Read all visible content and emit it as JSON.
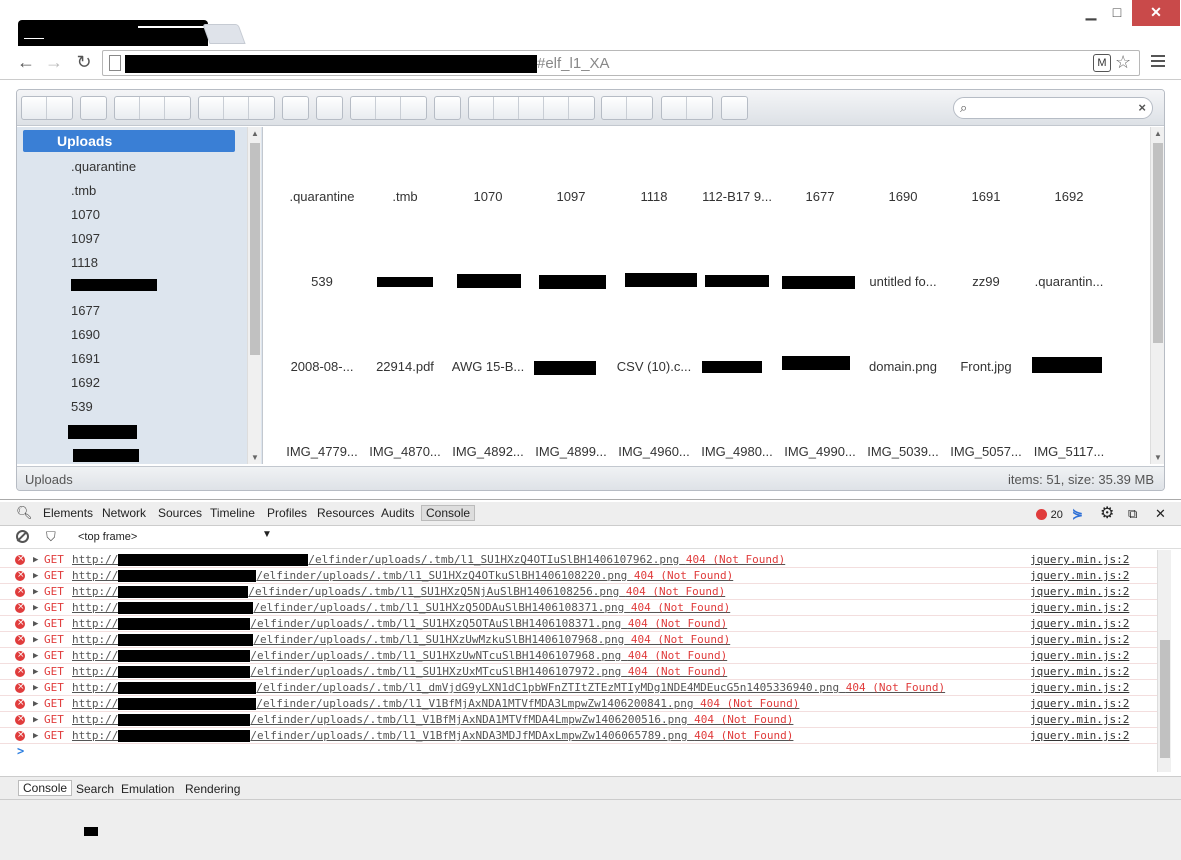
{
  "browser": {
    "url_visible_suffix": "#elf_l1_XA",
    "window_controls": {
      "minimize": "▁",
      "maximize": "□",
      "close": "✕"
    }
  },
  "finder": {
    "search_placeholder": "",
    "tree": {
      "root": "Uploads",
      "items": [
        ".quarantine",
        ".tmb",
        "1070",
        "1097",
        "1118",
        "1677",
        "1690",
        "1691",
        "1692",
        "539"
      ]
    },
    "files": {
      "row1": [
        ".quarantine",
        ".tmb",
        "1070",
        "1097",
        "1118",
        "112-B17 9...",
        "1677",
        "1690",
        "1691",
        "1692"
      ],
      "row2": [
        "539",
        "",
        "",
        "",
        "",
        "",
        "",
        "untitled fo...",
        "zz99",
        ".quarantin..."
      ],
      "row3": [
        "2008-08-...",
        "22914.pdf",
        "AWG 15-B...",
        "",
        "CSV (10).c...",
        "",
        "",
        "domain.png",
        "Front.jpg",
        ""
      ],
      "row4": [
        "IMG_4779...",
        "IMG_4870...",
        "IMG_4892...",
        "IMG_4899...",
        "IMG_4960...",
        "IMG_4980...",
        "IMG_4990...",
        "IMG_5039...",
        "IMG_5057...",
        "IMG_5117..."
      ]
    },
    "status": {
      "path": "Uploads",
      "info": "items: 51, size: 35.39 MB"
    }
  },
  "devtools": {
    "tabs": [
      "Elements",
      "Network",
      "Sources",
      "Timeline",
      "Profiles",
      "Resources",
      "Audits",
      "Console"
    ],
    "active_tab": "Console",
    "error_count": "20",
    "frame_selector": "<top frame>",
    "console_rows": [
      {
        "method": "GET",
        "prefix": "http://",
        "path": "elfinder/uploads/.tmb/l1_SU1HXzQ4OTIuSlBH1406107962.png",
        "status": "404 (Not Found)",
        "source": "jquery.min.js:2"
      },
      {
        "method": "GET",
        "prefix": "http://",
        "path": "elfinder/uploads/.tmb/l1_SU1HXzQ4OTkuSlBH1406108220.png",
        "status": "404 (Not Found)",
        "source": "jquery.min.js:2"
      },
      {
        "method": "GET",
        "prefix": "http://",
        "path": "elfinder/uploads/.tmb/l1_SU1HXzQ5NjAuSlBH1406108256.png",
        "status": "404 (Not Found)",
        "source": "jquery.min.js:2"
      },
      {
        "method": "GET",
        "prefix": "http://",
        "path": "elfinder/uploads/.tmb/l1_SU1HXzQ5ODAuSlBH1406108371.png",
        "status": "404 (Not Found)",
        "source": "jquery.min.js:2"
      },
      {
        "method": "GET",
        "prefix": "http://",
        "path": "elfinder/uploads/.tmb/l1_SU1HXzQ5OTAuSlBH1406108371.png",
        "status": "404 (Not Found)",
        "source": "jquery.min.js:2"
      },
      {
        "method": "GET",
        "prefix": "http://",
        "path": "elfinder/uploads/.tmb/l1_SU1HXzUwMzkuSlBH1406107968.png",
        "status": "404 (Not Found)",
        "source": "jquery.min.js:2"
      },
      {
        "method": "GET",
        "prefix": "http://",
        "path": "elfinder/uploads/.tmb/l1_SU1HXzUwNTcuSlBH1406107968.png",
        "status": "404 (Not Found)",
        "source": "jquery.min.js:2"
      },
      {
        "method": "GET",
        "prefix": "http://",
        "path": "elfinder/uploads/.tmb/l1_SU1HXzUxMTcuSlBH1406107972.png",
        "status": "404 (Not Found)",
        "source": "jquery.min.js:2"
      },
      {
        "method": "GET",
        "prefix": "http://",
        "path": "elfinder/uploads/.tmb/l1_dmVjdG9yLXN1dC1pbWFnZTItZTEzMTIyMDg1NDE4MDEucG5n1405336940.png",
        "status": "404 (Not Found)",
        "source": "jquery.min.js:2"
      },
      {
        "method": "GET",
        "prefix": "http://",
        "path": "elfinder/uploads/.tmb/l1_V1BfMjAxNDA1MTVfMDA3LmpwZw1406200841.png",
        "status": "404 (Not Found)",
        "source": "jquery.min.js:2"
      },
      {
        "method": "GET",
        "prefix": "http://",
        "path": "elfinder/uploads/.tmb/l1_V1BfMjAxNDA1MTVfMDA4LmpwZw1406200516.png",
        "status": "404 (Not Found)",
        "source": "jquery.min.js:2"
      },
      {
        "method": "GET",
        "prefix": "http://",
        "path": "elfinder/uploads/.tmb/l1_V1BfMjAxNDA3MDJfMDAxLmpwZw1406065789.png",
        "status": "404 (Not Found)",
        "source": "jquery.min.js:2"
      }
    ],
    "prompt": ">",
    "drawer_tabs": [
      "Console",
      "Search",
      "Emulation",
      "Rendering"
    ],
    "drawer_active": "Console"
  }
}
